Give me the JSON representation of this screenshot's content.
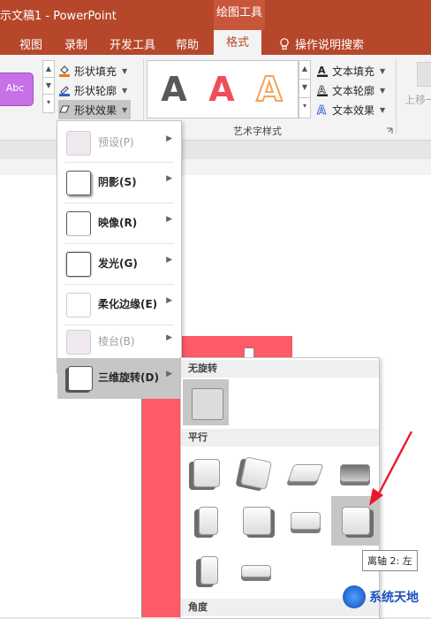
{
  "titlebar": {
    "title": "示文稿1  -  PowerPoint",
    "context_tab": "绘图工具"
  },
  "tabs": [
    {
      "label": "视图"
    },
    {
      "label": "录制"
    },
    {
      "label": "开发工具"
    },
    {
      "label": "帮助"
    },
    {
      "label": "格式"
    }
  ],
  "search": {
    "label": "操作说明搜索",
    "icon": "lightbulb-icon"
  },
  "ribbon": {
    "style_preview": "Abc",
    "shape_fill": "形状填充",
    "shape_outline": "形状轮廓",
    "shape_effects": "形状效果",
    "text_fill": "文本填充",
    "text_outline": "文本轮廓",
    "text_effects": "文本效果",
    "wordart_group": "艺术字样式",
    "wordart_letter": "A",
    "move_up": "上移一",
    "colors": {
      "fill_icon": "#e87a1f",
      "outline_icon": "#2c5fd0",
      "wordart_red": "#f04e5a",
      "wordart_orange": "#f5a25a",
      "wordart_gray": "#595959"
    }
  },
  "effects_menu": {
    "items": [
      {
        "label": "预设(P)",
        "enabled": false
      },
      {
        "label": "阴影(S)",
        "enabled": true
      },
      {
        "label": "映像(R)",
        "enabled": true
      },
      {
        "label": "发光(G)",
        "enabled": true
      },
      {
        "label": "柔化边缘(E)",
        "enabled": true
      },
      {
        "label": "棱台(B)",
        "enabled": false
      },
      {
        "label": "三维旋转(D)",
        "enabled": true,
        "active": true
      }
    ]
  },
  "rotation_gallery": {
    "section_no_rotation": "无旋转",
    "section_parallel": "平行",
    "section_angle": "角度",
    "selected_preset": "离轴 2: 左"
  },
  "tooltip": {
    "text": "离轴 2: 左"
  },
  "watermark": {
    "text": "系统天地"
  },
  "accent": {
    "ribbon_red": "#b7472a",
    "shape_pink": "#ff5a67",
    "arrow_red": "#e8192c"
  }
}
